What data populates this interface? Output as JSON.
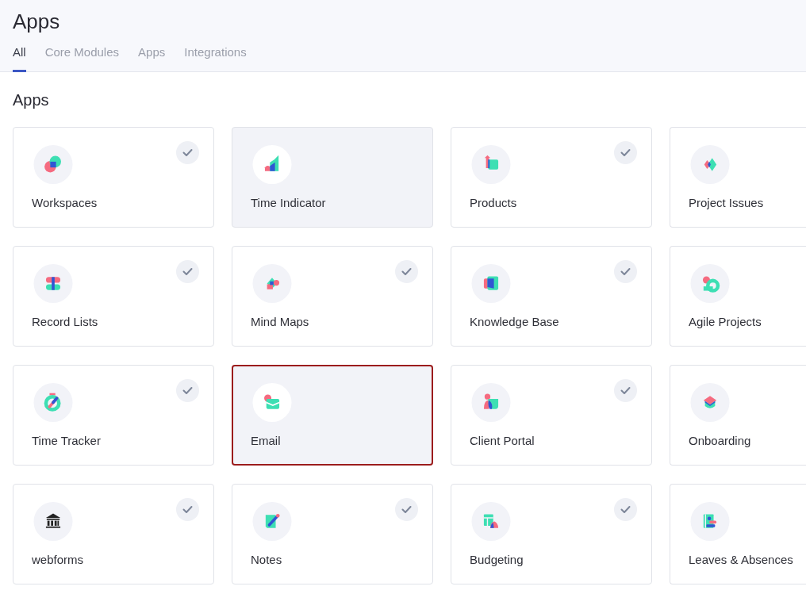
{
  "header": {
    "title": "Apps"
  },
  "tabs": [
    {
      "label": "All",
      "selected": true
    },
    {
      "label": "Core Modules",
      "selected": false
    },
    {
      "label": "Apps",
      "selected": false
    },
    {
      "label": "Integrations",
      "selected": false
    }
  ],
  "section": {
    "title": "Apps"
  },
  "apps": [
    {
      "name": "Workspaces",
      "installed": true,
      "highlighted": false,
      "focused": false
    },
    {
      "name": "Time Indicator",
      "installed": false,
      "highlighted": true,
      "focused": false
    },
    {
      "name": "Products",
      "installed": true,
      "highlighted": false,
      "focused": false
    },
    {
      "name": "Project Issues",
      "installed": false,
      "highlighted": false,
      "focused": false
    },
    {
      "name": "Record Lists",
      "installed": true,
      "highlighted": false,
      "focused": false
    },
    {
      "name": "Mind Maps",
      "installed": true,
      "highlighted": false,
      "focused": false
    },
    {
      "name": "Knowledge Base",
      "installed": true,
      "highlighted": false,
      "focused": false
    },
    {
      "name": "Agile Projects",
      "installed": false,
      "highlighted": false,
      "focused": false
    },
    {
      "name": "Time Tracker",
      "installed": true,
      "highlighted": false,
      "focused": false
    },
    {
      "name": "Email",
      "installed": false,
      "highlighted": true,
      "focused": true
    },
    {
      "name": "Client Portal",
      "installed": true,
      "highlighted": false,
      "focused": false
    },
    {
      "name": "Onboarding",
      "installed": false,
      "highlighted": false,
      "focused": false
    },
    {
      "name": "webforms",
      "installed": true,
      "highlighted": false,
      "focused": false
    },
    {
      "name": "Notes",
      "installed": true,
      "highlighted": false,
      "focused": false
    },
    {
      "name": "Budgeting",
      "installed": true,
      "highlighted": false,
      "focused": false
    },
    {
      "name": "Leaves & Absences",
      "installed": false,
      "highlighted": false,
      "focused": false
    }
  ]
}
